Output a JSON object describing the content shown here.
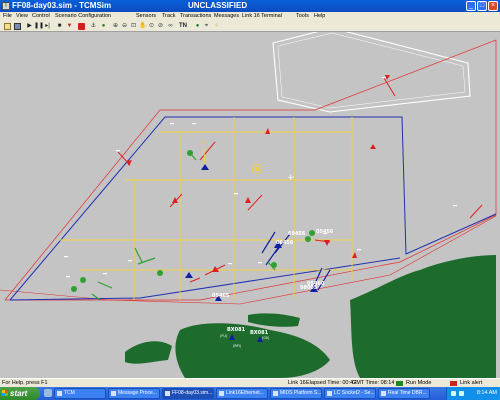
{
  "window": {
    "app_icon": "tcm-app-icon",
    "title": "FF08-day03.sim - TCMSim",
    "classification": "UNCLASSIFIED",
    "buttons": {
      "minimize": "_",
      "maximize": "□",
      "close": "×"
    }
  },
  "menu": {
    "items": [
      "File",
      "View",
      "Control",
      "Scenario Configuration",
      "Sensors",
      "Track",
      "Transactions",
      "Messages",
      "Link 16 Terminal"
    ],
    "right_items": [
      "Tools",
      "Help"
    ]
  },
  "toolbar": {
    "icons": [
      "open-icon",
      "save-icon",
      "play-icon",
      "pause-icon",
      "stop-icon",
      "record-icon",
      "step-icon",
      "anchor-icon",
      "globe-icon",
      "zoom-in-icon",
      "zoom-out-icon",
      "zoom-box-icon",
      "pan-icon",
      "center-icon",
      "range-icon",
      "binoculars-icon",
      "track-number-icon",
      "globe2-icon",
      "target-icon",
      "bulb-icon"
    ],
    "tn_label": "TN"
  },
  "map": {
    "colors": {
      "background": "#c4c4c4",
      "land": "#1e6b2e",
      "grid": "#f0d040",
      "boundary_blue": "#2030b0",
      "boundary_red": "#e03030",
      "hostile": "#e02020",
      "friendly": "#1020a0",
      "neutral": "#30a030",
      "white": "#ffffff"
    },
    "track_labels": [
      "69456",
      "05456",
      "98005",
      "05460",
      "05465",
      "06456",
      "BX081",
      "BX081"
    ],
    "small_labels": [
      "(RFI)",
      "(FU)",
      "(00)"
    ]
  },
  "status": {
    "help_text": "For Help, press F1",
    "link": "Link 16",
    "elapsed": "Elapsed Time: 00:47",
    "gmt": "GMT Time: 08:14",
    "run_mode": "Run Mode",
    "link_alert": "Link alert",
    "run_mode_color": "#1e8a1e",
    "link_alert_color": "#d02020"
  },
  "taskbar": {
    "start_label": "start",
    "tasks": [
      {
        "label": "TCM",
        "active": false
      },
      {
        "label": "Message Proce...",
        "active": false
      },
      {
        "label": "FF08-day03.sim...",
        "active": true
      },
      {
        "label": "Link16Ethernet...",
        "active": false
      },
      {
        "label": "MIDS Platform S...",
        "active": false
      },
      {
        "label": "LC Socket2 - Se...",
        "active": false
      },
      {
        "label": "Real Time DBR...",
        "active": false
      }
    ],
    "clock": "8:14 AM"
  }
}
